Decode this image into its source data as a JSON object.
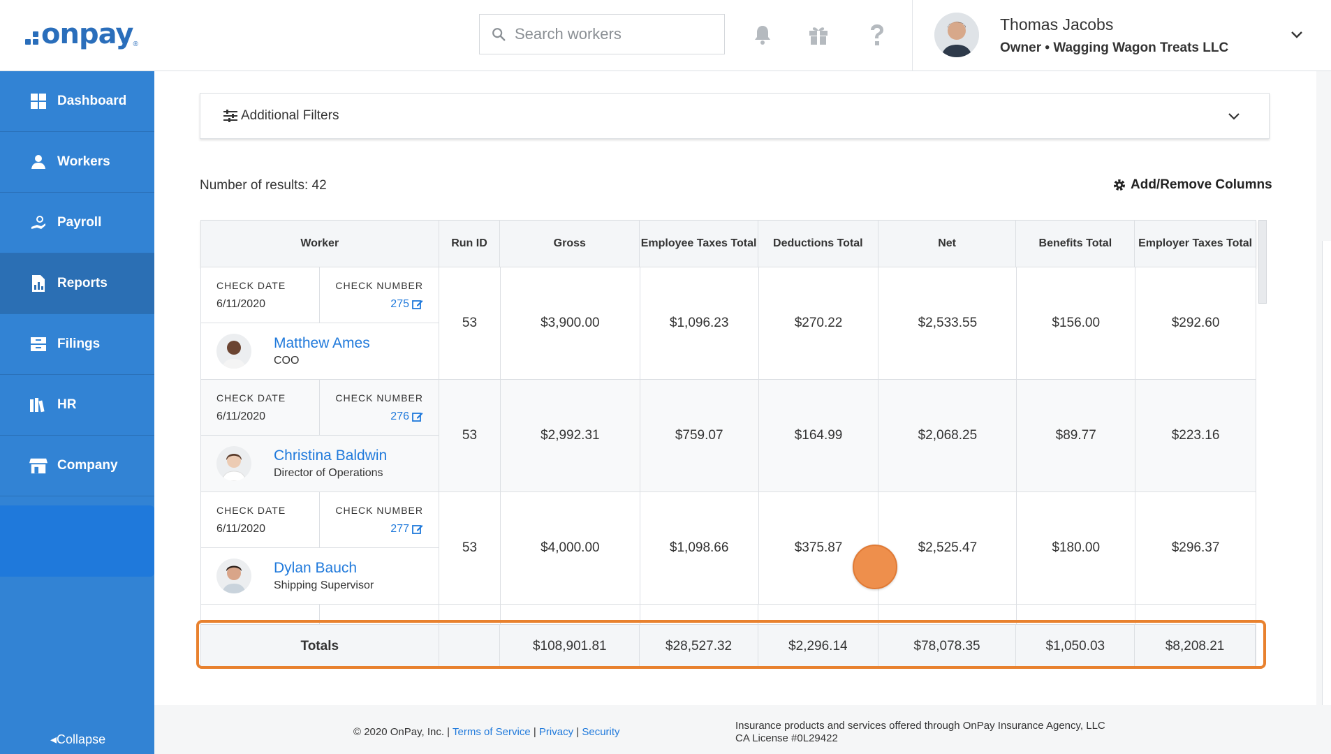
{
  "brand": {
    "logo_text": "onpay",
    "logo_reg": "®"
  },
  "header": {
    "search_placeholder": "Search workers",
    "icons": [
      "bell-icon",
      "gift-icon",
      "help-icon"
    ],
    "user": {
      "name": "Thomas Jacobs",
      "subtitle": "Owner • Wagging Wagon Treats LLC"
    }
  },
  "sidebar": {
    "items": [
      {
        "label": "Dashboard",
        "icon": "dashboard-icon"
      },
      {
        "label": "Workers",
        "icon": "workers-icon"
      },
      {
        "label": "Payroll",
        "icon": "payroll-icon"
      },
      {
        "label": "Reports",
        "icon": "reports-icon",
        "active": true
      },
      {
        "label": "Filings",
        "icon": "filings-icon"
      },
      {
        "label": "HR",
        "icon": "hr-icon"
      },
      {
        "label": "Company",
        "icon": "company-icon"
      }
    ],
    "collapse_label": "Collapse"
  },
  "filters": {
    "label": "Additional Filters"
  },
  "results": {
    "text": "Number of results: 42"
  },
  "add_columns": {
    "label": "Add/Remove Columns"
  },
  "table": {
    "headers": [
      "Worker",
      "Run ID",
      "Gross",
      "Employee Taxes Total",
      "Deductions Total",
      "Net",
      "Benefits Total",
      "Employer Taxes Total"
    ],
    "check_date_label": "CHECK DATE",
    "check_number_label": "CHECK NUMBER",
    "rows": [
      {
        "check_date": "6/11/2020",
        "check_number": "275",
        "name": "Matthew Ames",
        "title": "COO",
        "run_id": "53",
        "gross": "$3,900.00",
        "emp_taxes": "$1,096.23",
        "deductions": "$270.22",
        "net": "$2,533.55",
        "benefits": "$156.00",
        "employer_taxes": "$292.60"
      },
      {
        "check_date": "6/11/2020",
        "check_number": "276",
        "name": "Christina Baldwin",
        "title": "Director of Operations",
        "run_id": "53",
        "gross": "$2,992.31",
        "emp_taxes": "$759.07",
        "deductions": "$164.99",
        "net": "$2,068.25",
        "benefits": "$89.77",
        "employer_taxes": "$223.16"
      },
      {
        "check_date": "6/11/2020",
        "check_number": "277",
        "name": "Dylan Bauch",
        "title": "Shipping Supervisor",
        "run_id": "53",
        "gross": "$4,000.00",
        "emp_taxes": "$1,098.66",
        "deductions": "$375.87",
        "net": "$2,525.47",
        "benefits": "$180.00",
        "employer_taxes": "$296.37"
      }
    ],
    "totals": {
      "label": "Totals",
      "run_id": "",
      "gross": "$108,901.81",
      "emp_taxes": "$28,527.32",
      "deductions": "$2,296.14",
      "net": "$78,078.35",
      "benefits": "$1,050.03",
      "employer_taxes": "$8,208.21"
    }
  },
  "footer": {
    "copyright": "© 2020 OnPay, Inc. |",
    "links": [
      "Terms of Service",
      "Privacy",
      "Security"
    ],
    "insurance_line1": "Insurance products and services offered through OnPay Insurance Agency, LLC",
    "insurance_line2": "CA License #0L29422"
  },
  "colors": {
    "brand_blue": "#2a6ebb",
    "sidebar": "#3283d4",
    "link": "#1f79db",
    "highlight": "#e8812e"
  }
}
